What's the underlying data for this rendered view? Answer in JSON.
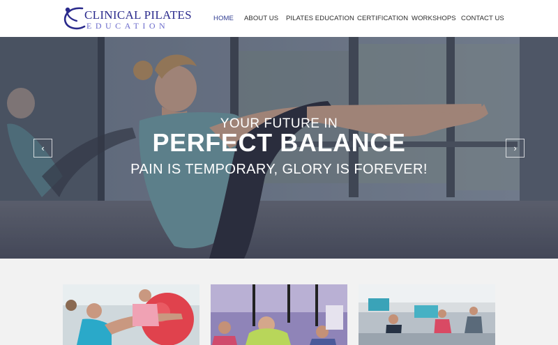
{
  "brand": {
    "name_line1": "CLINICAL PILATES",
    "name_line2": "EDUCATION"
  },
  "nav": {
    "items": [
      {
        "label": "HOME",
        "active": true
      },
      {
        "label": "ABOUT US",
        "active": false
      },
      {
        "label": "PILATES EDUCATION",
        "active": false
      },
      {
        "label": "CERTIFICATION",
        "active": false
      },
      {
        "label": "WORKSHOPS",
        "active": false
      },
      {
        "label": "CONTACT US",
        "active": false
      }
    ]
  },
  "hero": {
    "subtitle": "YOUR FUTURE IN",
    "title": "PERFECT BALANCE",
    "tagline": "PAIN IS TEMPORARY, GLORY IS FOREVER!",
    "prev_icon": "chevron-left-icon",
    "next_icon": "chevron-right-icon"
  },
  "cards": [
    {
      "image": "exercise-ball-class-photo"
    },
    {
      "image": "suspension-training-class-photo"
    },
    {
      "image": "reformer-studio-class-photo"
    }
  ],
  "colors": {
    "nav_active": "#2d3a8f",
    "nav_text": "#2b2b2b",
    "brand_blue": "#2a2a8c",
    "page_bg": "#f2f2f2"
  }
}
